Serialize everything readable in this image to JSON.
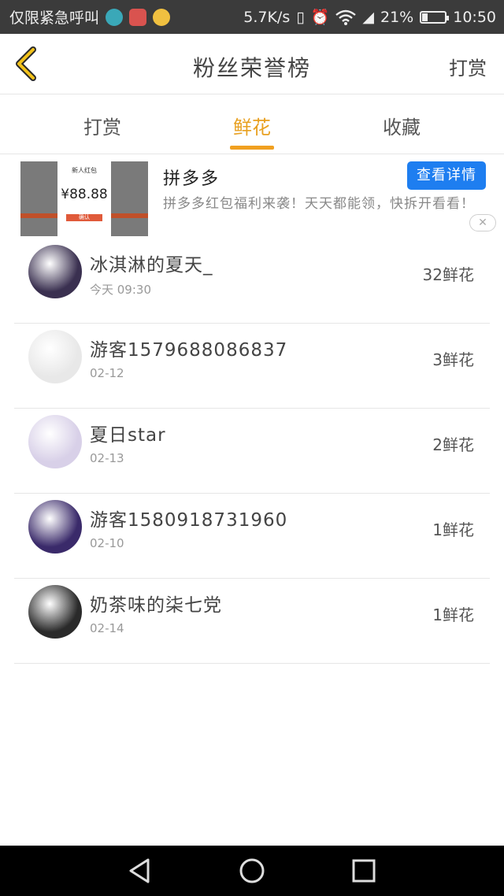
{
  "status_bar": {
    "carrier": "仅限紧急呼叫",
    "speed": "5.7K/s",
    "battery_percent": "21%",
    "battery_level": 0.21,
    "time": "10:50"
  },
  "nav": {
    "title": "粉丝荣誉榜",
    "action": "打赏"
  },
  "tabs": [
    {
      "label": "打赏",
      "active": false
    },
    {
      "label": "鲜花",
      "active": true
    },
    {
      "label": "收藏",
      "active": false
    }
  ],
  "ad": {
    "card_title": "新人红包",
    "card_amount": "¥88.88",
    "card_button": "确认",
    "name": "拼多多",
    "description": "拼多多红包福利来袭！天天都能领，快拆开看看！",
    "button_label": "查看详情",
    "close_label": "✕"
  },
  "list": [
    {
      "name": "冰淇淋的夏天_",
      "date": "今天 09:30",
      "count": "32鲜花",
      "avatar_color": "#3a3050"
    },
    {
      "name": "游客1579688086837",
      "date": "02-12",
      "count": "3鲜花",
      "avatar_color": "#e8e8e8"
    },
    {
      "name": "夏日star",
      "date": "02-13",
      "count": "2鲜花",
      "avatar_color": "#d8d0e8"
    },
    {
      "name": "游客1580918731960",
      "date": "02-10",
      "count": "1鲜花",
      "avatar_color": "#3a2a6a"
    },
    {
      "name": "奶茶味的柒七党",
      "date": "02-14",
      "count": "1鲜花",
      "avatar_color": "#2a2a2a"
    }
  ],
  "colors": {
    "accent": "#f0a020",
    "ad_button": "#1e7ef0"
  }
}
